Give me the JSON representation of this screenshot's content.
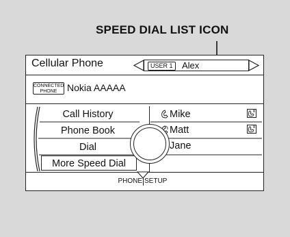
{
  "callout": {
    "text": "SPEED DIAL LIST ICON"
  },
  "header": {
    "title": "Cellular Phone",
    "user_tag": "USER 1",
    "user_name": "Alex"
  },
  "phone": {
    "badge_line1": "CONNECTED",
    "badge_line2": "PHONE",
    "name": "Nokia AAAAA"
  },
  "menu": {
    "items": [
      {
        "label": "Call History"
      },
      {
        "label": "Phone Book"
      },
      {
        "label": "Dial"
      },
      {
        "label": "More Speed Dial",
        "selected": true
      }
    ]
  },
  "speed_dial": {
    "entries": [
      {
        "name": "Mike",
        "type_icon": "mobile-phone-icon",
        "list_icon": true
      },
      {
        "name": "Matt",
        "type_icon": "home-phone-icon",
        "list_icon": true
      },
      {
        "name": "Jane",
        "type_icon": "work-phone-icon",
        "list_icon": false
      }
    ]
  },
  "footer": {
    "left_label": "PHONE",
    "right_label": "SETUP"
  }
}
